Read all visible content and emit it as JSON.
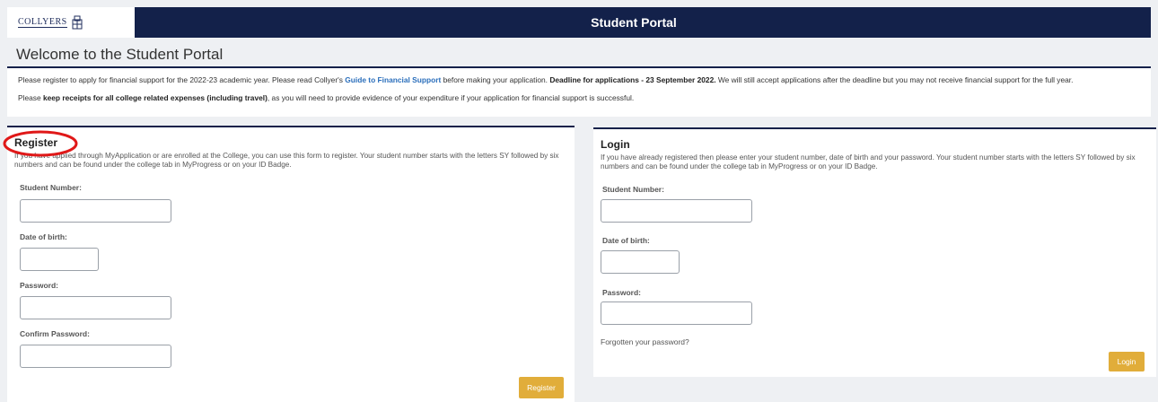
{
  "header": {
    "logo_text": "COLLYERS",
    "title": "Student Portal"
  },
  "welcome": {
    "title": "Welcome to the Student Portal"
  },
  "notice": {
    "line1_before": "Please register to apply for financial support for the 2022-23 academic year. Please read Collyer's ",
    "line1_link": "Guide to Financial Support",
    "line1_middle": " before making your application. ",
    "line1_bold": "Deadline for applications - 23 September 2022.",
    "line1_after": " We will still accept applications after the deadline but you may not receive financial support for the full year.",
    "line2_before": "Please ",
    "line2_bold": "keep receipts for all college related expenses (including travel)",
    "line2_after": ", as you will need to provide evidence of your expenditure if your application for financial support is successful."
  },
  "register": {
    "title": "Register",
    "description": "If you have applied through MyApplication or are enrolled at the College, you can use this form to register. Your student number starts with the letters SY followed by six numbers and can be found under the college tab in MyProgress or on your ID Badge.",
    "student_number_label": "Student Number:",
    "dob_label": "Date of birth:",
    "password_label": "Password:",
    "confirm_password_label": "Confirm Password:",
    "student_number_value": "",
    "dob_value": "",
    "password_value": "",
    "confirm_password_value": "",
    "button_label": "Register"
  },
  "login": {
    "title": "Login",
    "description": "If you have already registered then please enter your student number, date of birth and your password. Your student number starts with the letters SY followed by six numbers and can be found under the college tab in MyProgress or on your ID Badge.",
    "student_number_label": "Student Number:",
    "dob_label": "Date of birth:",
    "password_label": "Password:",
    "student_number_value": "",
    "dob_value": "",
    "password_value": "",
    "forgot_link": "Forgotten your password?",
    "button_label": "Login"
  },
  "colors": {
    "navy": "#13214a",
    "accent_button": "#e1ad3a",
    "link": "#2a6ebb",
    "annotation_red": "#e01818"
  },
  "icons": {
    "logo": "college-crest-icon"
  }
}
